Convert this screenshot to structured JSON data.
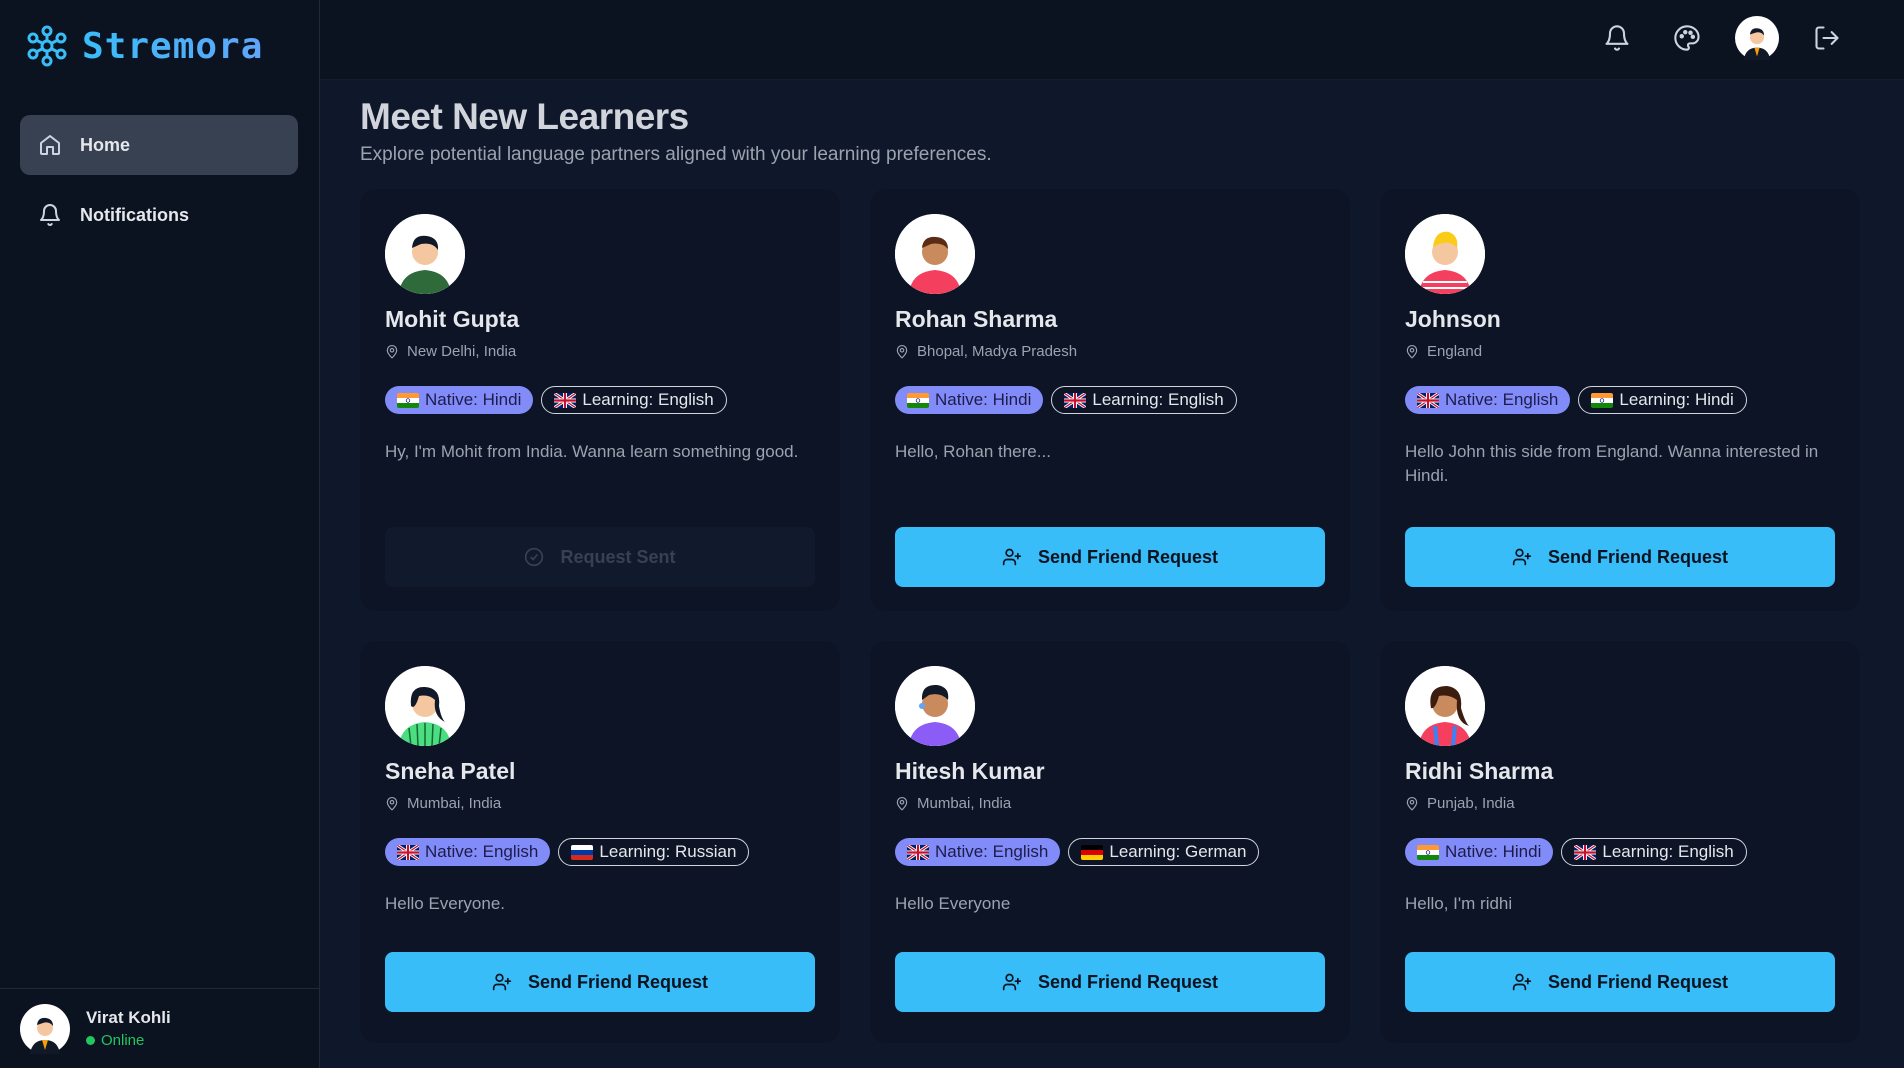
{
  "app": {
    "name": "Stremora"
  },
  "sidebar": {
    "items": [
      {
        "label": "Home",
        "icon": "home-icon",
        "active": true
      },
      {
        "label": "Notifications",
        "icon": "bell-icon",
        "active": false
      }
    ],
    "user": {
      "name": "Virat Kohli",
      "status": "Online"
    }
  },
  "topbar": {
    "icons": [
      "bell-icon",
      "palette-icon",
      "user-avatar",
      "logout-icon"
    ]
  },
  "page": {
    "title": "Meet New Learners",
    "subtitle": "Explore potential language partners aligned with your learning preferences."
  },
  "learners": [
    {
      "name": "Mohit Gupta",
      "location": "New Delhi, India",
      "native": "Native: Hindi",
      "native_flag": "in",
      "learning": "Learning: English",
      "learning_flag": "gb",
      "bio": "Hy, I'm Mohit from India. Wanna learn something good.",
      "button": "Request Sent",
      "sent": true,
      "avatar_color": "#2f6b3a"
    },
    {
      "name": "Rohan Sharma",
      "location": "Bhopal, Madya Pradesh",
      "native": "Native: Hindi",
      "native_flag": "in",
      "learning": "Learning: English",
      "learning_flag": "gb",
      "bio": "Hello, Rohan there...",
      "button": "Send Friend Request",
      "sent": false,
      "avatar_color": "#f43f5e"
    },
    {
      "name": "Johnson",
      "location": "England",
      "native": "Native: English",
      "native_flag": "gb",
      "learning": "Learning: Hindi",
      "learning_flag": "in",
      "bio": "Hello John this side from England. Wanna interested in Hindi.",
      "button": "Send Friend Request",
      "sent": false,
      "avatar_color": "#f43f5e"
    },
    {
      "name": "Sneha Patel",
      "location": "Mumbai, India",
      "native": "Native: English",
      "native_flag": "gb",
      "learning": "Learning: Russian",
      "learning_flag": "ru",
      "bio": "Hello Everyone.",
      "button": "Send Friend Request",
      "sent": false,
      "avatar_color": "#4ade80"
    },
    {
      "name": "Hitesh Kumar",
      "location": "Mumbai, India",
      "native": "Native: English",
      "native_flag": "gb",
      "learning": "Learning: German",
      "learning_flag": "de",
      "bio": "Hello Everyone",
      "button": "Send Friend Request",
      "sent": false,
      "avatar_color": "#8b5cf6"
    },
    {
      "name": "Ridhi Sharma",
      "location": "Punjab, India",
      "native": "Native: Hindi",
      "native_flag": "in",
      "learning": "Learning: English",
      "learning_flag": "gb",
      "bio": "Hello, I'm ridhi",
      "button": "Send Friend Request",
      "sent": false,
      "avatar_color": "#f43f5e"
    }
  ],
  "colors": {
    "accent": "#38bdf8",
    "native_badge": "#818cf8",
    "online": "#22c55e",
    "background": "#0f172a"
  }
}
